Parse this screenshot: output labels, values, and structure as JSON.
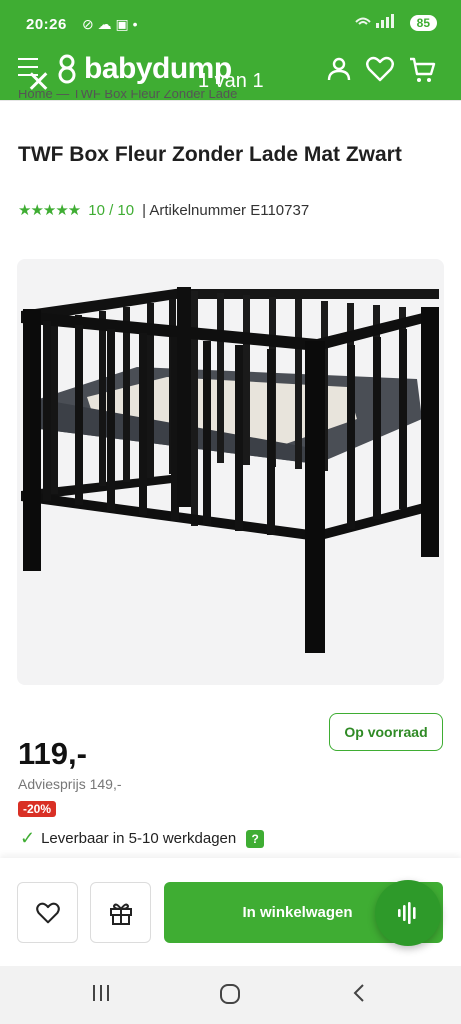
{
  "status_bar": {
    "time": "20:26",
    "left_icons": "⊘ ☁ ▣ •",
    "signal": "📶",
    "battery": "85"
  },
  "header": {
    "logo_text": "babydump",
    "image_counter": "1 van 1"
  },
  "breadcrumb": {
    "text": "Home  —  TWF Box Fleur Zonder Lade"
  },
  "product": {
    "title": "TWF Box Fleur Zonder Lade Mat Zwart",
    "stars": "★★★★★",
    "rating": "10 / 10",
    "article_number": "| Artikelnummer  E110737",
    "stock_label": "Op voorraad",
    "price": "119,-",
    "advice_price": "Adviesprijs 149,-",
    "discount": "-20%",
    "delivery": "Leverbaar in 5-10 werkdagen",
    "help": "?"
  },
  "actions": {
    "add_to_cart": "In winkelwagen"
  },
  "colors": {
    "brand_green": "#3fad33",
    "discount_red": "#d93025"
  }
}
